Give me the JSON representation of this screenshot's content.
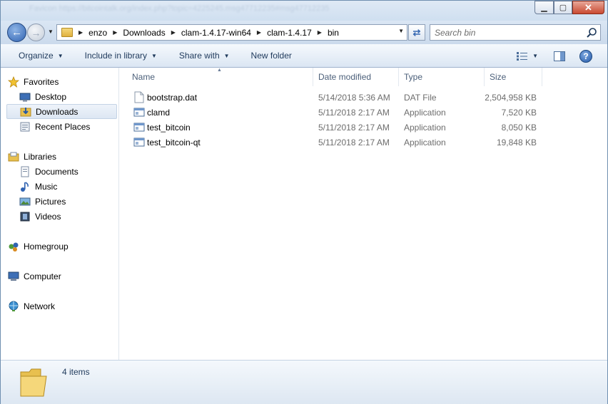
{
  "window": {
    "blurred_url": "Favicon  https://bitcointalk.org/index.php?topic=4225245.msg47712235#msg47712235",
    "close_symbol": "✕",
    "minimize_symbol": "▁",
    "maximize_symbol": "▢"
  },
  "address_bar": {
    "crumbs": [
      "enzo",
      "Downloads",
      "clam-1.4.17-win64",
      "clam-1.4.17",
      "bin"
    ]
  },
  "search": {
    "placeholder": "Search bin"
  },
  "toolbar": {
    "organize": "Organize",
    "include_in_library": "Include in library",
    "share_with": "Share with",
    "new_folder": "New folder",
    "help": "?"
  },
  "nav": {
    "favorites": "Favorites",
    "desktop": "Desktop",
    "downloads": "Downloads",
    "recent_places": "Recent Places",
    "libraries": "Libraries",
    "documents": "Documents",
    "music": "Music",
    "pictures": "Pictures",
    "videos": "Videos",
    "homegroup": "Homegroup",
    "computer": "Computer",
    "network": "Network"
  },
  "columns": {
    "name": "Name",
    "date_modified": "Date modified",
    "type": "Type",
    "size": "Size"
  },
  "files": [
    {
      "name": "bootstrap.dat",
      "date": "5/14/2018 5:36 AM",
      "type": "DAT File",
      "size": "2,504,958 KB",
      "icon": "document-icon"
    },
    {
      "name": "clamd",
      "date": "5/11/2018 2:17 AM",
      "type": "Application",
      "size": "7,520 KB",
      "icon": "application-icon"
    },
    {
      "name": "test_bitcoin",
      "date": "5/11/2018 2:17 AM",
      "type": "Application",
      "size": "8,050 KB",
      "icon": "application-icon"
    },
    {
      "name": "test_bitcoin-qt",
      "date": "5/11/2018 2:17 AM",
      "type": "Application",
      "size": "19,848 KB",
      "icon": "application-icon"
    }
  ],
  "status": {
    "item_count": "4 items"
  },
  "colors": {
    "title_bg": "#d6e3f3",
    "toolbar_text": "#1e395b",
    "close_red": "#c94a31",
    "selection": "#dde7f3",
    "folder_yellow": "#e8c04f"
  }
}
